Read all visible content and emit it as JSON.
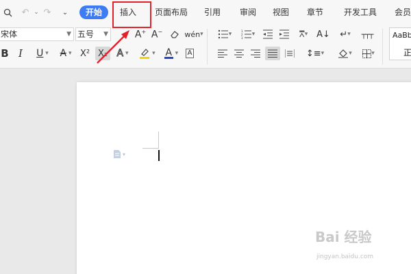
{
  "tabs": [
    {
      "label": "开始",
      "active": true
    },
    {
      "label": "插入",
      "active": false
    },
    {
      "label": "页面布局",
      "active": false
    },
    {
      "label": "引用",
      "active": false
    },
    {
      "label": "审阅",
      "active": false
    },
    {
      "label": "视图",
      "active": false
    },
    {
      "label": "章节",
      "active": false
    },
    {
      "label": "开发工具",
      "active": false
    },
    {
      "label": "会员",
      "active": false
    }
  ],
  "toolbar": {
    "font_name": "宋体",
    "font_size": "五号",
    "superscript": "X²",
    "subscript": "X₂",
    "phonetic": "wén"
  },
  "styles": {
    "preview": "AaBb",
    "name": "正"
  },
  "colors": {
    "accent": "#3d7cf3",
    "annotation": "#e0222a",
    "highlight": "#f2d500",
    "font_color": "#2a46c8"
  },
  "watermark": {
    "brand": "Bai 经验",
    "url": "jingyan.baidu.com"
  }
}
